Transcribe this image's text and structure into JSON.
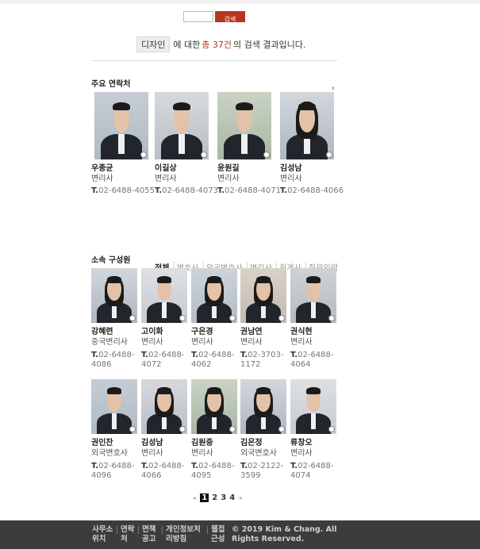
{
  "search": {
    "button_label": "검색"
  },
  "result": {
    "keyword": "디자인",
    "prefix": "에 대한",
    "count_text": "총 37건",
    "suffix": "의 검색 결과입니다."
  },
  "main_contacts": {
    "title": "주요 연락처",
    "people": [
      {
        "name": "우종균",
        "role": "변리사",
        "tel_prefix": "T.",
        "tel": "02-6488-4055"
      },
      {
        "name": "이길상",
        "role": "변리사",
        "tel_prefix": "T.",
        "tel": "02-6488-4073"
      },
      {
        "name": "윤원길",
        "role": "변리사",
        "tel_prefix": "T.",
        "tel": "02-6488-4071"
      },
      {
        "name": "김성남",
        "role": "변리사",
        "tel_prefix": "T.",
        "tel": "02-6488-4066"
      }
    ]
  },
  "members": {
    "title": "소속 구성원",
    "filters": [
      "전체",
      "변호사",
      "외국변호사",
      "변리사",
      "회계사",
      "전문인력"
    ],
    "people": [
      {
        "name": "강혜련",
        "role": "중국변리사",
        "tel_prefix": "T.",
        "tel1": "02-6488-",
        "tel2": "4086"
      },
      {
        "name": "고이화",
        "role": "변리사",
        "tel_prefix": "T.",
        "tel1": "02-6488-",
        "tel2": "4072"
      },
      {
        "name": "구은경",
        "role": "변리사",
        "tel_prefix": "T.",
        "tel1": "02-6488-",
        "tel2": "4062"
      },
      {
        "name": "권남연",
        "role": "변리사",
        "tel_prefix": "T.",
        "tel1": "02-3703-",
        "tel2": "1172"
      },
      {
        "name": "권식현",
        "role": "변리사",
        "tel_prefix": "T.",
        "tel1": "02-6488-",
        "tel2": "4064"
      },
      {
        "name": "권인찬",
        "role": "외국변호사",
        "tel_prefix": "T.",
        "tel1": "02-6488-",
        "tel2": "4096"
      },
      {
        "name": "김성남",
        "role": "변리사",
        "tel_prefix": "T.",
        "tel1": "02-6488-",
        "tel2": "4066"
      },
      {
        "name": "김원중",
        "role": "변리사",
        "tel_prefix": "T.",
        "tel1": "02-6488-",
        "tel2": "4095"
      },
      {
        "name": "김은정",
        "role": "외국변호사",
        "tel_prefix": "T.",
        "tel1": "02-2122-",
        "tel2": "3599"
      },
      {
        "name": "류창오",
        "role": "변리사",
        "tel_prefix": "T.",
        "tel1": "02-6488-",
        "tel2": "4074"
      }
    ]
  },
  "pagination": {
    "prev": "«",
    "pages": [
      "1",
      "2",
      "3",
      "4"
    ],
    "current": "1",
    "next": "»"
  },
  "footer": {
    "items": [
      {
        "line1": "사무소",
        "line2": "위치"
      },
      {
        "line1": "연락",
        "line2": "처"
      },
      {
        "line1": "면책",
        "line2": "공고"
      },
      {
        "line1": "개인정보처",
        "line2": "리방침"
      },
      {
        "line1": "웹접",
        "line2": "근성"
      }
    ],
    "copyright1": "© 2019 Kim & Chang. All",
    "copyright2": "Rights Reserved."
  },
  "colors": {
    "accent": "#b8361d",
    "footer_bg": "#3c3c3c"
  }
}
